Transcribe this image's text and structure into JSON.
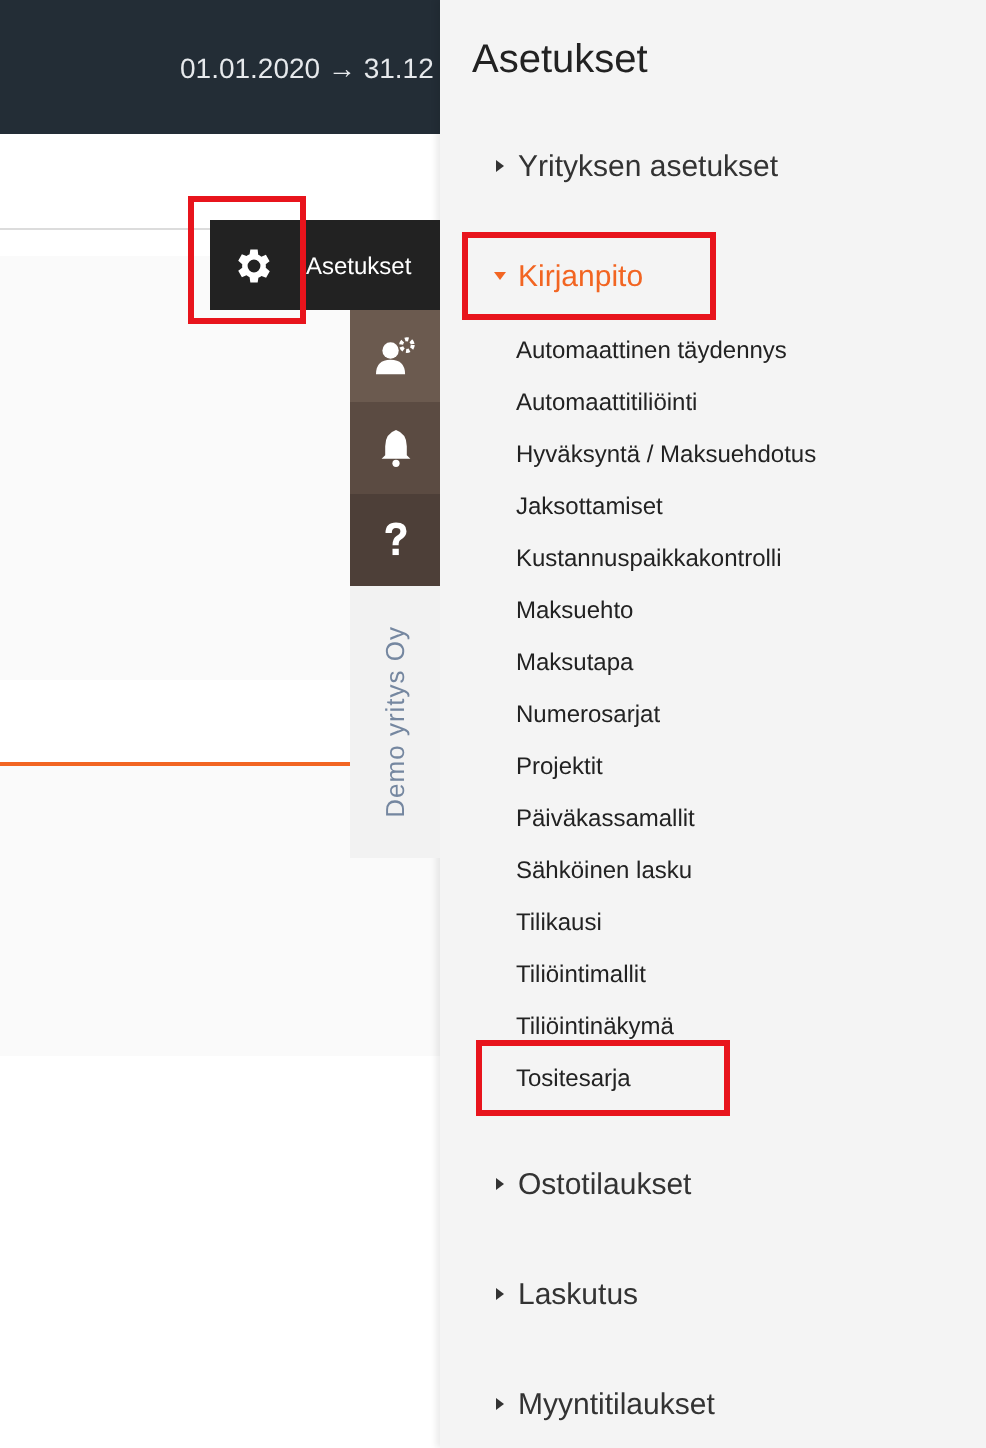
{
  "header": {
    "date_range": "01.01.2020 → 31.12"
  },
  "dock": {
    "settings_button": {
      "label": "Asetukset",
      "selected": true,
      "highlighted": true
    },
    "icons": [
      {
        "kind": "users"
      },
      {
        "kind": "bell"
      },
      {
        "kind": "help"
      }
    ],
    "company": "Demo yritys Oy"
  },
  "panel": {
    "title": "Asetukset",
    "sections": [
      {
        "label": "Yrityksen asetukset",
        "expanded": false,
        "highlighted": false
      },
      {
        "label": "Kirjanpito",
        "expanded": true,
        "highlighted": true,
        "children": [
          {
            "label": "Automaattinen täydennys",
            "highlighted": false
          },
          {
            "label": "Automaattitiliöinti",
            "highlighted": false
          },
          {
            "label": "Hyväksyntä / Maksuehdotus",
            "highlighted": false
          },
          {
            "label": "Jaksottamiset",
            "highlighted": false
          },
          {
            "label": "Kustannuspaikkakontrolli",
            "highlighted": false
          },
          {
            "label": "Maksuehto",
            "highlighted": false
          },
          {
            "label": "Maksutapa",
            "highlighted": false
          },
          {
            "label": "Numerosarjat",
            "highlighted": false
          },
          {
            "label": "Projektit",
            "highlighted": false
          },
          {
            "label": "Päiväkassamallit",
            "highlighted": false
          },
          {
            "label": "Sähköinen lasku",
            "highlighted": false
          },
          {
            "label": "Tilikausi",
            "highlighted": false
          },
          {
            "label": "Tiliöintimallit",
            "highlighted": false
          },
          {
            "label": "Tiliöintinäkymä",
            "highlighted": false
          },
          {
            "label": "Tositesarja",
            "highlighted": true
          }
        ]
      },
      {
        "label": "Ostotilaukset",
        "expanded": false,
        "highlighted": false
      },
      {
        "label": "Laskutus",
        "expanded": false,
        "highlighted": false
      },
      {
        "label": "Myyntitilaukset",
        "expanded": false,
        "highlighted": false
      }
    ]
  }
}
